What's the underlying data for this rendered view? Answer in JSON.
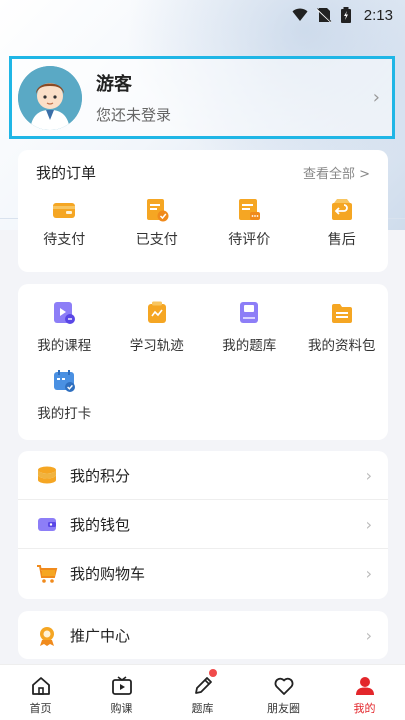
{
  "status_bar": {
    "time": "2:13"
  },
  "profile": {
    "name": "游客",
    "subtitle": "您还未登录"
  },
  "orders": {
    "title": "我的订单",
    "view_all": "查看全部 >",
    "items": [
      {
        "label": "待支付",
        "icon": "wallet-icon"
      },
      {
        "label": "已支付",
        "icon": "paid-order-icon"
      },
      {
        "label": "待评价",
        "icon": "review-icon"
      },
      {
        "label": "售后",
        "icon": "after-sales-icon"
      }
    ]
  },
  "tools": {
    "items": [
      {
        "label": "我的课程",
        "icon": "course-icon"
      },
      {
        "label": "学习轨迹",
        "icon": "learning-track-icon"
      },
      {
        "label": "我的题库",
        "icon": "question-bank-icon"
      },
      {
        "label": "我的资料包",
        "icon": "materials-icon"
      },
      {
        "label": "我的打卡",
        "icon": "checkin-icon"
      }
    ]
  },
  "menu": {
    "items": [
      {
        "label": "我的积分",
        "icon": "points-icon"
      },
      {
        "label": "我的钱包",
        "icon": "wallet-menu-icon"
      },
      {
        "label": "我的购物车",
        "icon": "cart-icon"
      }
    ]
  },
  "promo": {
    "label": "推广中心",
    "icon": "promotion-icon"
  },
  "tabbar": {
    "items": [
      {
        "label": "首页",
        "icon": "home-icon"
      },
      {
        "label": "购课",
        "icon": "buy-course-icon"
      },
      {
        "label": "题库",
        "icon": "pencil-icon"
      },
      {
        "label": "朋友圈",
        "icon": "heart-icon"
      },
      {
        "label": "我的",
        "icon": "user-icon"
      }
    ],
    "active_index": 4
  },
  "colors": {
    "accent": "#e3262b",
    "highlight_border": "#1fb6e6",
    "order_icon": "#f5a623",
    "tool_icon": "#7b6cf6"
  }
}
